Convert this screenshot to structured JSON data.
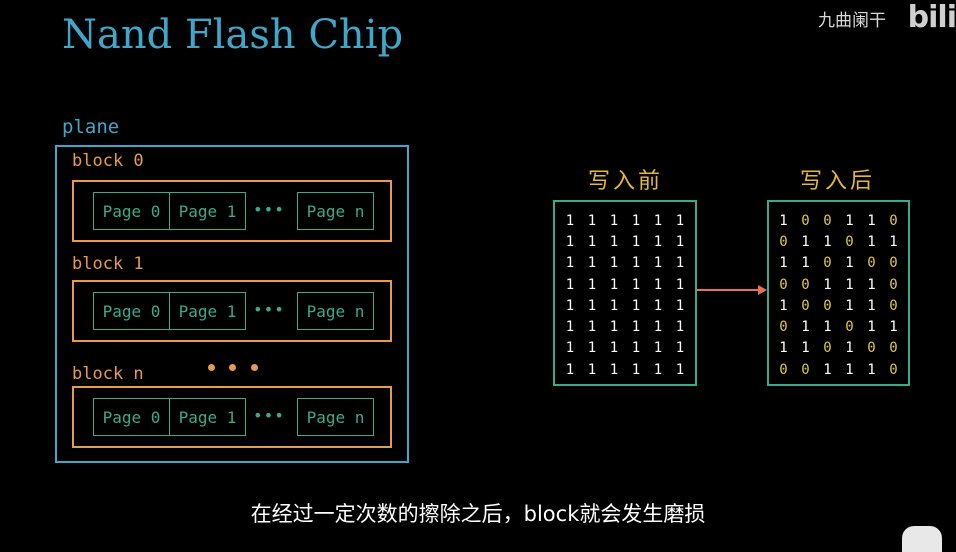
{
  "title": "Nand Flash Chip",
  "watermark": "九曲阑干",
  "bilibili_logo": "bilibili",
  "plane_label": "plane",
  "blocks": [
    {
      "label": "block 0",
      "pages": [
        "Page 0",
        "Page 1",
        "Page n"
      ],
      "dots": "•••"
    },
    {
      "label": "block 1",
      "pages": [
        "Page 0",
        "Page 1",
        "Page n"
      ],
      "dots": "•••"
    },
    {
      "label": "block n",
      "pages": [
        "Page 0",
        "Page 1",
        "Page n"
      ],
      "dots": "•••"
    }
  ],
  "before_label": "写入前",
  "after_label": "写入后",
  "before_matrix": [
    [
      "1",
      "1",
      "1",
      "1",
      "1",
      "1"
    ],
    [
      "1",
      "1",
      "1",
      "1",
      "1",
      "1"
    ],
    [
      "1",
      "1",
      "1",
      "1",
      "1",
      "1"
    ],
    [
      "1",
      "1",
      "1",
      "1",
      "1",
      "1"
    ],
    [
      "1",
      "1",
      "1",
      "1",
      "1",
      "1"
    ],
    [
      "1",
      "1",
      "1",
      "1",
      "1",
      "1"
    ],
    [
      "1",
      "1",
      "1",
      "1",
      "1",
      "1"
    ],
    [
      "1",
      "1",
      "1",
      "1",
      "1",
      "1"
    ]
  ],
  "after_matrix": [
    [
      "1",
      "0",
      "0",
      "1",
      "1",
      "0"
    ],
    [
      "0",
      "1",
      "1",
      "0",
      "1",
      "1"
    ],
    [
      "1",
      "1",
      "0",
      "1",
      "0",
      "0"
    ],
    [
      "0",
      "0",
      "1",
      "1",
      "1",
      "0"
    ],
    [
      "1",
      "0",
      "0",
      "1",
      "1",
      "0"
    ],
    [
      "0",
      "1",
      "1",
      "0",
      "1",
      "1"
    ],
    [
      "1",
      "1",
      "0",
      "1",
      "0",
      "0"
    ],
    [
      "0",
      "0",
      "1",
      "1",
      "1",
      "0"
    ]
  ],
  "colors": {
    "plane": "#3fa7c9",
    "block": "#e89a4f",
    "page": "#3aaa8c",
    "one": "#ffffff",
    "zero": "#e3c93c",
    "arrow": "#e8705a"
  },
  "subtitle": "在经过一定次数的擦除之后，block就会发生磨损"
}
